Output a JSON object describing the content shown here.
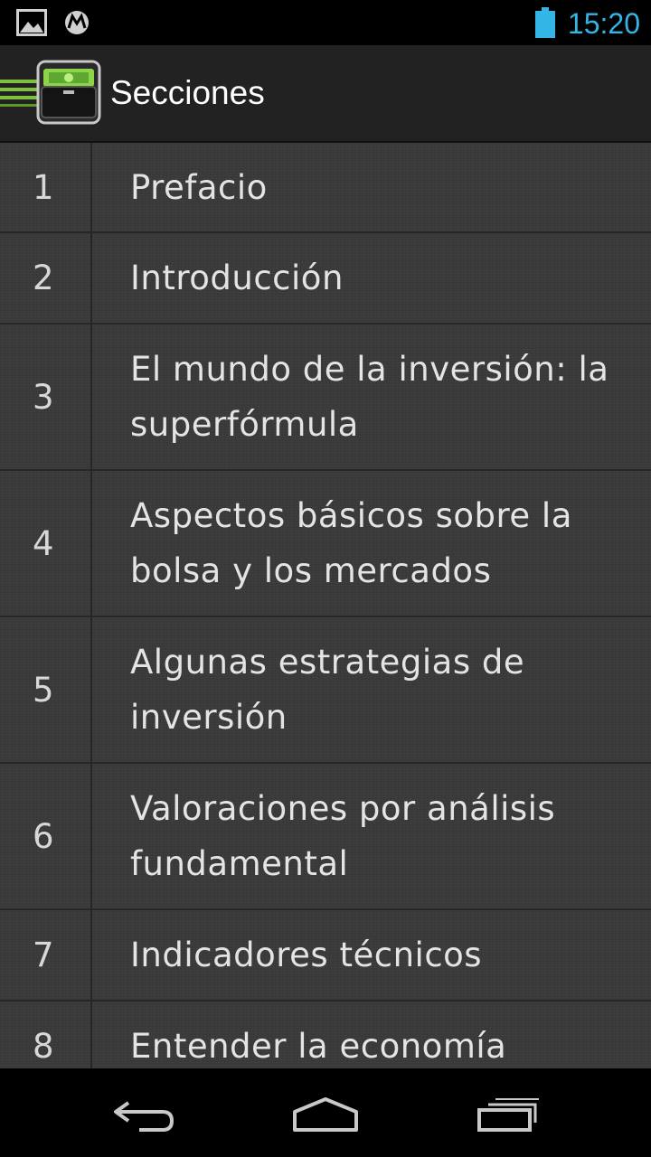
{
  "status_bar": {
    "time": "15:20",
    "icons": [
      "image-notification-icon",
      "motorola-icon",
      "battery-icon"
    ],
    "time_color": "#33b5e5"
  },
  "action_bar": {
    "title": "Secciones",
    "icons": [
      "drawer-indicator-icon",
      "wallet-app-icon"
    ]
  },
  "sections": [
    {
      "number": "1",
      "title": "Prefacio"
    },
    {
      "number": "2",
      "title": "Introducción"
    },
    {
      "number": "3",
      "title": "El mundo de la inversión: la superfórmula"
    },
    {
      "number": "4",
      "title": "Aspectos básicos sobre la bolsa y los mercados"
    },
    {
      "number": "5",
      "title": "Algunas estrategias de inversión"
    },
    {
      "number": "6",
      "title": "Valoraciones por análisis fundamental"
    },
    {
      "number": "7",
      "title": "Indicadores técnicos"
    },
    {
      "number": "8",
      "title": "Entender la economía"
    }
  ],
  "nav_bar": {
    "icons": [
      "back-icon",
      "home-icon",
      "recent-apps-icon"
    ]
  }
}
